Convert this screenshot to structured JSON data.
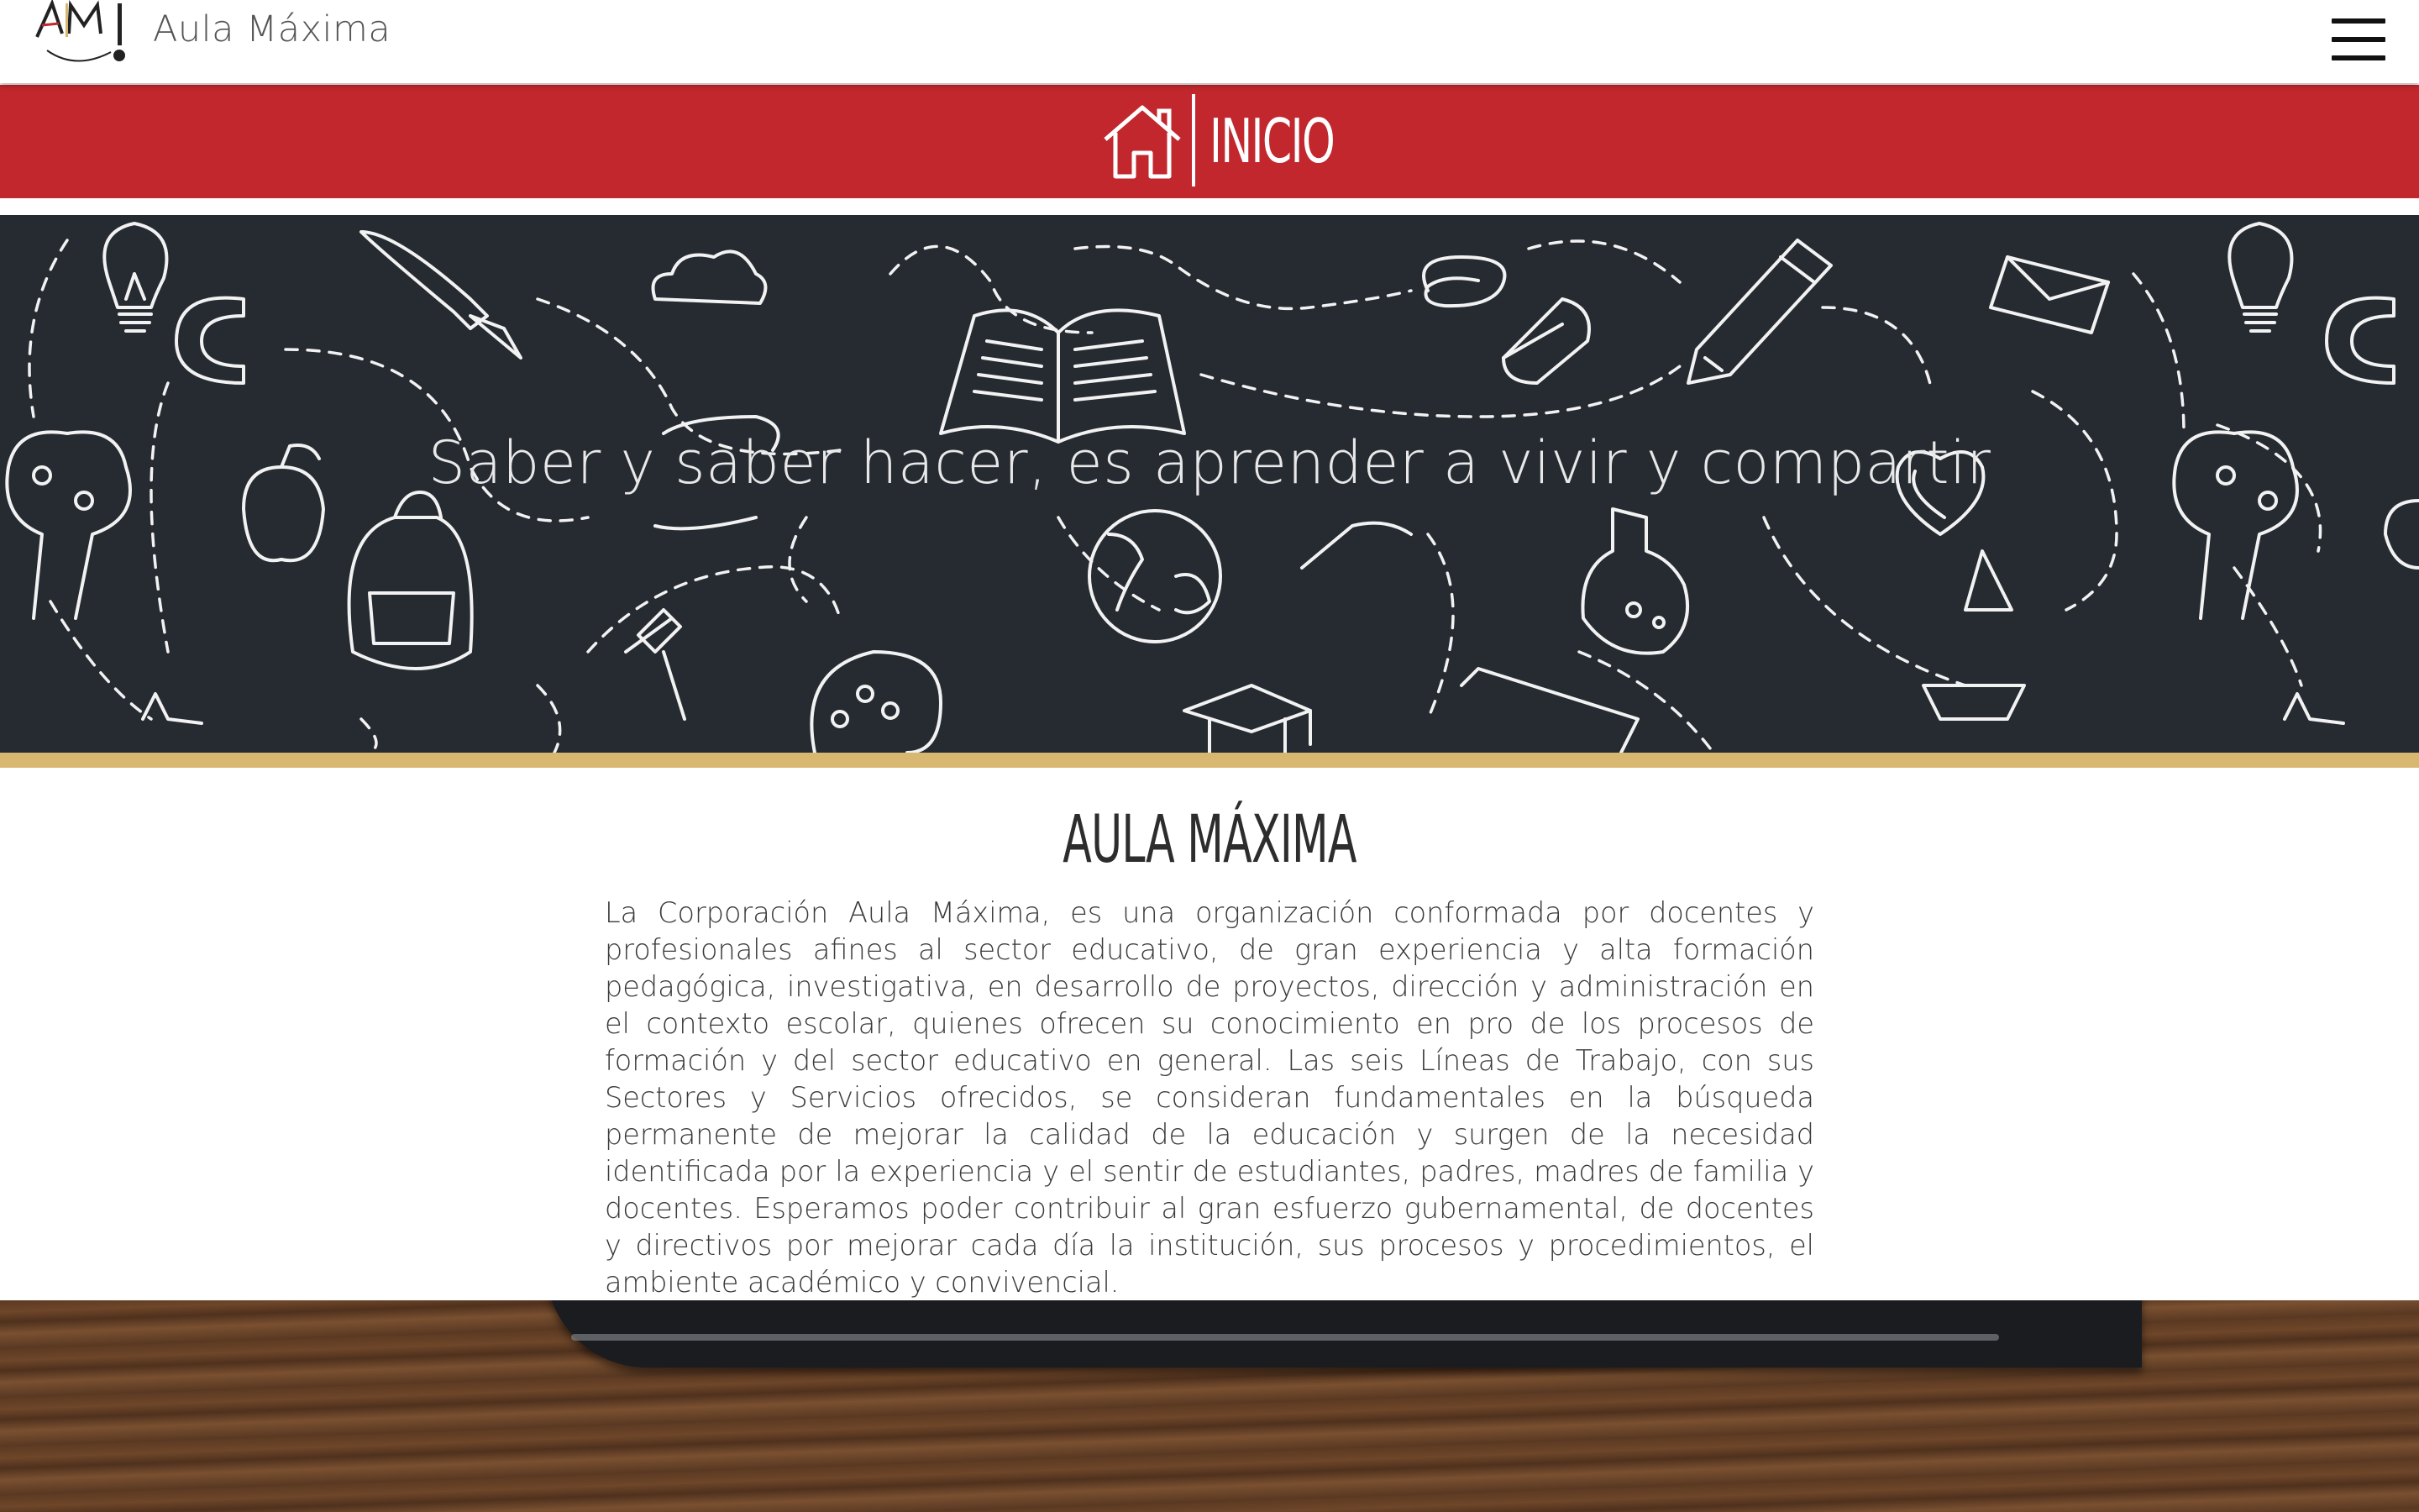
{
  "header": {
    "brand_name": "Aula Máxima",
    "logo_alt": "AM",
    "menu_icon": "hamburger-menu-icon"
  },
  "page_banner": {
    "icon": "home-icon",
    "title": "INICIO",
    "color": "#c1272d"
  },
  "hero": {
    "tagline": "Saber y saber hacer, es aprender a vivir y compartir",
    "background_color": "#262b32",
    "accent_bar_color": "#d8b871"
  },
  "about": {
    "title": "AULA MÁXIMA",
    "text": "La Corporación Aula Máxima, es una organización conformada por docentes y profesionales afines al sector educativo, de gran experiencia y alta formación pedagógica, investigativa, en desarrollo de proyectos, dirección y administración en el contexto escolar, quienes ofrecen su conocimiento en pro de los procesos de formación y del sector educativo en general. Las seis Líneas de Trabajo, con sus Sectores y Servicios ofrecidos, se consideran fundamentales en la búsqueda permanente de mejorar la calidad de la educación y surgen de la necesidad identificada por la experiencia y el sentir de estudiantes, padres, madres de familia y docentes. Esperamos poder contribuir al gran esfuerzo gubernamental, de docentes y directivos por mejorar cada día la institución, sus procesos y procedimientos, el ambiente académico y convivencial."
  }
}
